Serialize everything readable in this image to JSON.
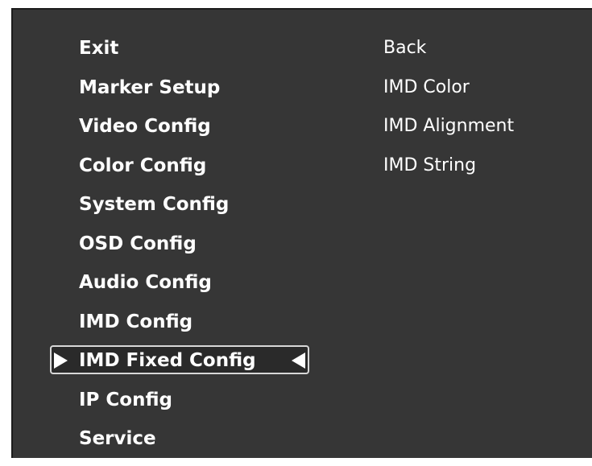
{
  "main_menu": {
    "items": [
      {
        "label": "Exit"
      },
      {
        "label": "Marker Setup"
      },
      {
        "label": "Video Config"
      },
      {
        "label": "Color Config"
      },
      {
        "label": "System Config"
      },
      {
        "label": "OSD Config"
      },
      {
        "label": "Audio Config"
      },
      {
        "label": "IMD Config"
      },
      {
        "label": "IMD Fixed Config",
        "selected": true
      },
      {
        "label": "IP Config"
      },
      {
        "label": "Service"
      }
    ]
  },
  "sub_menu": {
    "items": [
      {
        "label": "Back"
      },
      {
        "label": "IMD Color"
      },
      {
        "label": "IMD Alignment"
      },
      {
        "label": "IMD String"
      }
    ]
  },
  "icons": {
    "selection_left": "triangle-right-icon",
    "selection_right": "triangle-left-icon"
  },
  "colors": {
    "background": "#363636",
    "text": "#ffffff",
    "selection_border": "#d8d8d8"
  }
}
